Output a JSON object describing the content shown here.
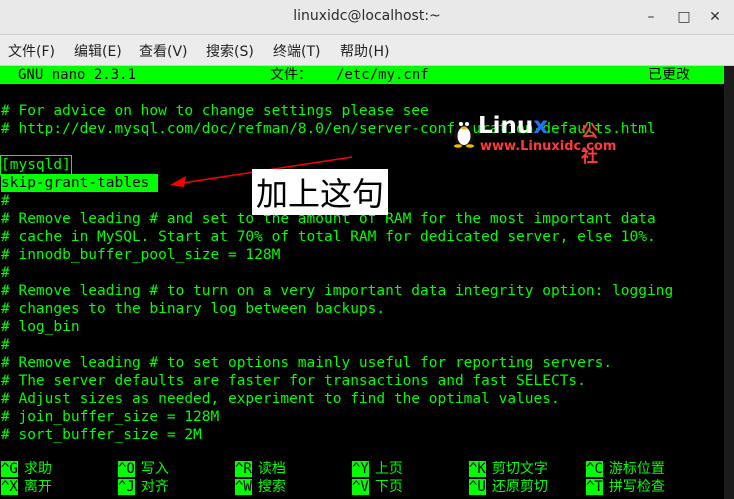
{
  "window": {
    "title": "linuxidc@localhost:~",
    "minimize": "–",
    "maximize": "□",
    "close": "✕"
  },
  "menu": [
    "文件(F)",
    "编辑(E)",
    "查看(V)",
    "搜索(S)",
    "终端(T)",
    "帮助(H)"
  ],
  "nano": {
    "version": "GNU nano 2.3.1",
    "file_label": "文件：",
    "file_path": "/etc/my.cnf",
    "status": "已更改"
  },
  "lines": [
    "",
    "# For advice on how to change settings please see",
    "# http://dev.mysql.com/doc/refman/8.0/en/server-configuration-defaults.html",
    "",
    "[mysqld]",
    "skip-grant-tables ",
    "#",
    "# Remove leading # and set to the amount of RAM for the most important data",
    "# cache in MySQL. Start at 70% of total RAM for dedicated server, else 10%.",
    "# innodb_buffer_pool_size = 128M",
    "#",
    "# Remove leading # to turn on a very important data integrity option: logging",
    "# changes to the binary log between backups.",
    "# log_bin",
    "#",
    "# Remove leading # to set options mainly useful for reporting servers.",
    "# The server defaults are faster for transactions and fast SELECTs.",
    "# Adjust sizes as needed, experiment to find the optimal values.",
    "# join_buffer_size = 128M",
    "# sort_buffer_size = 2M"
  ],
  "annotation": "加上这句",
  "logo": {
    "brand_a": "Linu",
    "brand_b": "x",
    "brand_cn": "公社",
    "url": "www.Linuxidc.com"
  },
  "shortcuts_row1": [
    {
      "key": "^G",
      "label": "求助"
    },
    {
      "key": "^O",
      "label": "写入"
    },
    {
      "key": "^R",
      "label": "读档"
    },
    {
      "key": "^Y",
      "label": "上页"
    },
    {
      "key": "^K",
      "label": "剪切文字"
    },
    {
      "key": "^C",
      "label": "游标位置"
    }
  ],
  "shortcuts_row2": [
    {
      "key": "^X",
      "label": "离开"
    },
    {
      "key": "^J",
      "label": "对齐"
    },
    {
      "key": "^W",
      "label": "搜索"
    },
    {
      "key": "^V",
      "label": "下页"
    },
    {
      "key": "^U",
      "label": "还原剪切"
    },
    {
      "key": "^T",
      "label": "拼写检查"
    }
  ],
  "colors": {
    "terminal_fg": "#00ff00",
    "terminal_bg": "#000000",
    "annotation_arrow": "#ff0000"
  }
}
